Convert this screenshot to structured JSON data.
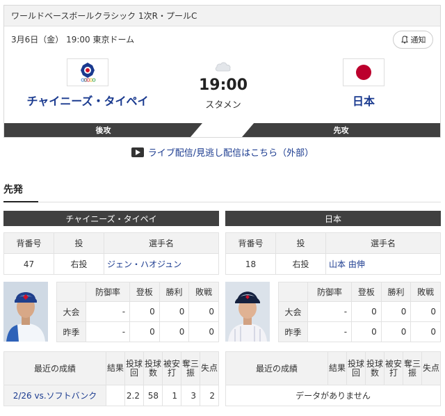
{
  "header": {
    "title": "ワールドベースボールクラシック 1次R・プールC",
    "meta": "3月6日（金） 19:00 東京ドーム",
    "notify_label": "通知"
  },
  "game": {
    "time": "19:00",
    "status": "スタメン",
    "weather_icon": "cloud-icon"
  },
  "teams": {
    "away": {
      "name": "チャイニーズ・タイペイ",
      "bat_order": "後攻",
      "flag_icon": "chinese-taipei-flag-icon"
    },
    "home": {
      "name": "日本",
      "bat_order": "先攻",
      "flag_icon": "japan-flag-icon",
      "flag_color": "#bc002d"
    }
  },
  "live_link": "ライブ配信/見逃し配信はこちら（外部）",
  "section": {
    "title": "先発"
  },
  "starters": {
    "headers": {
      "number": "背番号",
      "throw": "投",
      "name": "選手名"
    },
    "stat_headers": {
      "era": "防御率",
      "games": "登板",
      "wins": "勝利",
      "losses": "敗戦"
    },
    "stat_rows": {
      "tournament": "大会",
      "last_season": "昨季"
    },
    "recent_headers": {
      "label": "最近の成績",
      "result": "結果",
      "ip": "投球回",
      "pitches": "投球数",
      "hits": "被安打",
      "so": "奪三振",
      "er": "失点"
    },
    "left": {
      "team": "チャイニーズ・タイペイ",
      "number": "47",
      "throw": "右投",
      "player": "ジェン・ハオジュン",
      "tournament": {
        "era": "-",
        "games": "0",
        "wins": "0",
        "losses": "0"
      },
      "last_season": {
        "era": "-",
        "games": "0",
        "wins": "0",
        "losses": "0"
      },
      "recent": [
        {
          "label": "2/26 vs.ソフトバンク",
          "result": "",
          "ip": "2.2",
          "pitches": "58",
          "hits": "1",
          "so": "3",
          "er": "2"
        }
      ]
    },
    "right": {
      "team": "日本",
      "number": "18",
      "throw": "右投",
      "player": "山本 由伸",
      "tournament": {
        "era": "-",
        "games": "0",
        "wins": "0",
        "losses": "0"
      },
      "last_season": {
        "era": "-",
        "games": "0",
        "wins": "0",
        "losses": "0"
      },
      "no_data": "データがありません"
    }
  },
  "colors": {
    "accent": "#1a3a8f",
    "bar": "#404040",
    "header_bg": "#f2f2f2"
  }
}
